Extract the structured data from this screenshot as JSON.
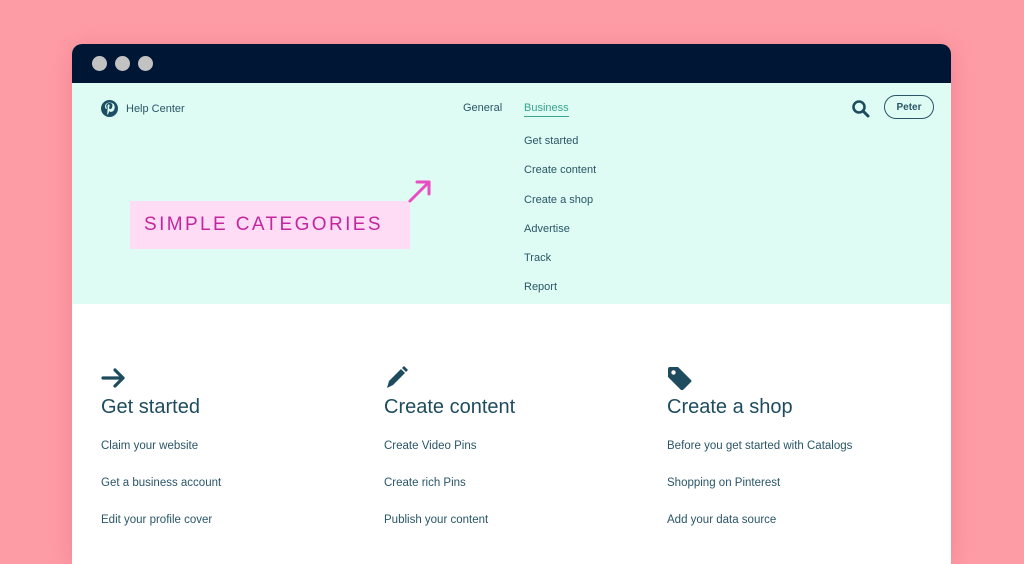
{
  "window": {
    "controls": [
      "close",
      "minimize",
      "maximize"
    ]
  },
  "header": {
    "brand": {
      "icon": "pinterest-logo-icon",
      "label": "Help Center"
    },
    "nav": [
      {
        "label": "General",
        "active": false
      },
      {
        "label": "Business",
        "active": true
      }
    ],
    "dropdown": [
      "Get started",
      "Create content",
      "Create a shop",
      "Advertise",
      "Track",
      "Report"
    ],
    "search_icon": "search-icon",
    "user_button": "Peter"
  },
  "annotation": {
    "label": "SIMPLE CATEGORIES",
    "arrow": "arrow-up-right-icon"
  },
  "categories": [
    {
      "icon": "arrow-right-icon",
      "title": "Get started",
      "links": [
        "Claim your website",
        "Get a business account",
        "Edit your profile cover"
      ]
    },
    {
      "icon": "pencil-icon",
      "title": "Create content",
      "links": [
        "Create Video Pins",
        "Create rich Pins",
        "Publish your content"
      ]
    },
    {
      "icon": "tag-icon",
      "title": "Create a shop",
      "links": [
        "Before you get started with Catalogs",
        "Shopping on Pinterest",
        "Add your data source"
      ]
    }
  ],
  "colors": {
    "background": "#fe9ca6",
    "titlebar": "#001635",
    "header_bg": "#defcf3",
    "text": "#2a5668",
    "active": "#3aa393",
    "callout_bg": "#ffdcf5",
    "callout_text": "#c2279e"
  }
}
